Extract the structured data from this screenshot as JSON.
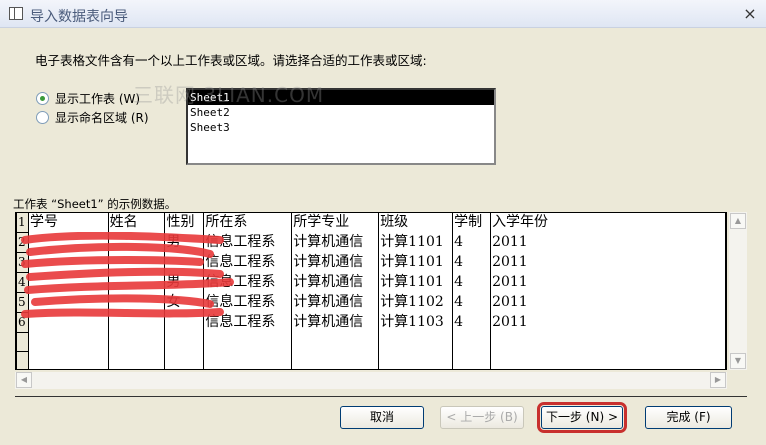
{
  "window": {
    "title": "导入数据表向导",
    "close": "×"
  },
  "instruction": "电子表格文件含有一个以上工作表或区域。请选择合适的工作表或区域:",
  "watermark": "三联网 3LIAN.COM",
  "radios": [
    {
      "label": "显示工作表 (W)",
      "checked": true
    },
    {
      "label": "显示命名区域 (R)",
      "checked": false
    }
  ],
  "sheets": [
    "Sheet1",
    "Sheet2",
    "Sheet3"
  ],
  "selected_sheet": "Sheet1",
  "caption": "工作表 “Sheet1” 的示例数据。",
  "table": {
    "row_numbers": [
      "1",
      "2",
      "3",
      "4",
      "5",
      "6",
      "",
      ""
    ],
    "rows": [
      [
        "学号",
        "姓名",
        "性别",
        "所在系",
        "所学专业",
        "班级",
        "学制",
        "入学年份"
      ],
      [
        "",
        "",
        "男",
        "信息工程系",
        "计算机通信",
        "计算1101",
        "4",
        "2011"
      ],
      [
        "",
        "",
        "",
        "信息工程系",
        "计算机通信",
        "计算1101",
        "4",
        "2011"
      ],
      [
        "",
        "",
        "男",
        "信息工程系",
        "计算机通信",
        "计算1101",
        "4",
        "2011"
      ],
      [
        "",
        "",
        "女",
        "信息工程系",
        "计算机通信",
        "计算1102",
        "4",
        "2011"
      ],
      [
        "",
        "",
        "",
        "信息工程系",
        "计算机通信",
        "计算1103",
        "4",
        "2011"
      ],
      [
        "",
        "",
        "",
        "",
        "",
        "",
        "",
        ""
      ],
      [
        "",
        "",
        "",
        "",
        "",
        "",
        "",
        ""
      ]
    ]
  },
  "buttons": {
    "cancel": "取消",
    "back": "< 上一步 (B)",
    "next": "下一步 (N) >",
    "finish": "完成 (F)"
  },
  "colors": {
    "highlight": "#c8302e",
    "redaction": "#e8393a"
  }
}
